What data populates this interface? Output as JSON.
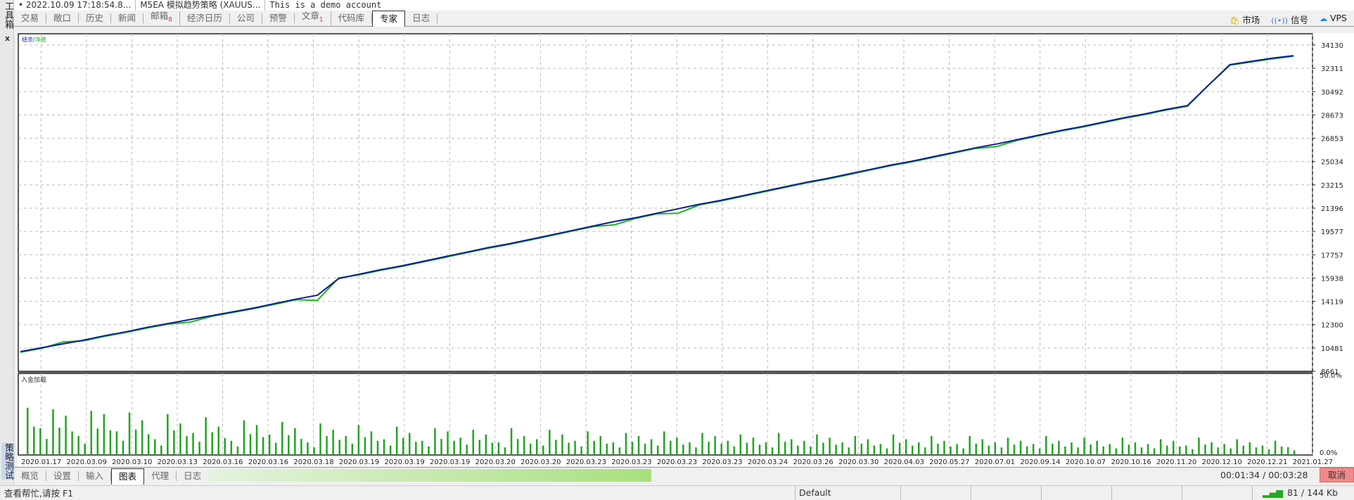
{
  "sidebar": {
    "toolbox_label": "工具箱",
    "tester_label": "策略测试"
  },
  "header": {
    "time": "• 2022.10.09 17:18:54.8...",
    "expert": "M5EA 模拟趋势策略 (XAUUS...",
    "account": "This is a demo account"
  },
  "tabs": [
    {
      "label": "交易"
    },
    {
      "label": "敞口"
    },
    {
      "label": "历史"
    },
    {
      "label": "新闻"
    },
    {
      "label": "邮箱",
      "badge": "8"
    },
    {
      "label": "经济日历"
    },
    {
      "label": "公司"
    },
    {
      "label": "预警"
    },
    {
      "label": "文章",
      "badge": "1"
    },
    {
      "label": "代码库"
    },
    {
      "label": "专家",
      "active": true
    },
    {
      "label": "日志"
    }
  ],
  "right_links": [
    {
      "label": "市场",
      "icon": "shopping-bag-icon"
    },
    {
      "label": "信号",
      "icon": "signal-icon"
    },
    {
      "label": "VPS",
      "icon": "cloud-icon"
    }
  ],
  "close_label": "x",
  "chart_data": [
    {
      "type": "line",
      "legend": {
        "balance": "结余",
        "separator": "/",
        "equity": "净值"
      },
      "colors": {
        "balance": "#0a1f8f",
        "equity": "#22b422"
      },
      "ylim": [
        8661,
        34130
      ],
      "yticks": [
        "34130",
        "32311",
        "30492",
        "28673",
        "26853",
        "25034",
        "23215",
        "21396",
        "19577",
        "17757",
        "15938",
        "14119",
        "12300",
        "10481",
        "8661"
      ],
      "x_labels": [
        "2020.01.17",
        "2020.03.09",
        "2020.03.10",
        "2020.03.13",
        "2020.03.16",
        "2020.03.16",
        "2020.03.18",
        "2020.03.19",
        "2020.03.19",
        "2020.03.19",
        "2020.03.20",
        "2020.03.20",
        "2020.03.23",
        "2020.03.23",
        "2020.03.23",
        "2020.03.23",
        "2020.03.24",
        "2020.03.26",
        "2020.03.30",
        "2020.04.03",
        "2020.05.27",
        "2020.07.01",
        "2020.09.14",
        "2020.10.07",
        "2020.10.16",
        "2020.11.20",
        "2020.12.10",
        "2020.12.21",
        "2021.01.27"
      ],
      "balance": [
        10200,
        10500,
        10800,
        11100,
        11450,
        11750,
        12100,
        12400,
        12700,
        13000,
        13300,
        13600,
        13950,
        14300,
        14600,
        15900,
        16250,
        16600,
        16900,
        17250,
        17600,
        17950,
        18300,
        18600,
        18950,
        19300,
        19650,
        20000,
        20350,
        20650,
        21000,
        21350,
        21700,
        22000,
        22350,
        22700,
        23050,
        23400,
        23700,
        24050,
        24400,
        24750,
        25050,
        25400,
        25750,
        26100,
        26400,
        26750,
        27100,
        27450,
        27750,
        28100,
        28450,
        28750,
        29100,
        29400,
        31000,
        32600,
        32850,
        33100,
        33300
      ],
      "equity": [
        10150,
        10450,
        10950,
        11050,
        11400,
        11700,
        12050,
        12350,
        12500,
        12950,
        13250,
        13550,
        13900,
        14250,
        14200,
        15950,
        16200,
        16550,
        16850,
        17200,
        17550,
        17900,
        18250,
        18550,
        18900,
        19250,
        19600,
        19950,
        20100,
        20600,
        20950,
        21000,
        21650,
        21950,
        22300,
        22650,
        23000,
        23350,
        23650,
        24000,
        24350,
        24700,
        25000,
        25350,
        25700,
        26050,
        26200,
        26700,
        27050,
        27400,
        27700,
        28050,
        28400,
        28700,
        29050,
        29350,
        31000,
        32550,
        32800,
        33050,
        33250
      ]
    },
    {
      "type": "bar",
      "title": "入金加载",
      "color": "#22a422",
      "ylim": [
        0,
        50
      ],
      "yticks": [
        "50.0%",
        "0.0%"
      ],
      "values": [
        30,
        17,
        29,
        25,
        12,
        28,
        26,
        15,
        27,
        22,
        10,
        26,
        20,
        14,
        24,
        18,
        9,
        22,
        19,
        13,
        21,
        17,
        8,
        20,
        16,
        12,
        19,
        15,
        10,
        18,
        14,
        9,
        17,
        15,
        11,
        16,
        13,
        8,
        17,
        12,
        10,
        16,
        13,
        9,
        15,
        12,
        8,
        14,
        12,
        10,
        15,
        11,
        8,
        14,
        12,
        9,
        13,
        11,
        8,
        14,
        10,
        9,
        13,
        11,
        8,
        12,
        10,
        7,
        13,
        10,
        8,
        12,
        9,
        7,
        12,
        10,
        8,
        11,
        9,
        7,
        12,
        9,
        8,
        11,
        9,
        7,
        11,
        8,
        7,
        10,
        9,
        6,
        11,
        8,
        7,
        10,
        8,
        6,
        9,
        5
      ]
    }
  ],
  "bottom_tabs": [
    {
      "label": "概览"
    },
    {
      "label": "设置"
    },
    {
      "label": "输入"
    },
    {
      "label": "图表",
      "active": true
    },
    {
      "label": "代理"
    },
    {
      "label": "日志"
    }
  ],
  "progress": {
    "percent": 45,
    "timer": "00:01:34 / 00:03:28",
    "cancel_label": "取消"
  },
  "status": {
    "help": "查看帮忙,请按 F1",
    "profile": "Default",
    "traffic": "81 / 144 Kb"
  }
}
